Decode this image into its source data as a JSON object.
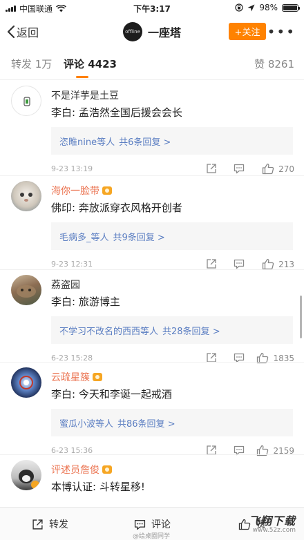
{
  "status_bar": {
    "carrier": "中国联通",
    "time": "下午3:17",
    "battery": "98%",
    "battery_level": 0.98
  },
  "nav": {
    "back_label": "返回",
    "avatar_text": "offline",
    "title": "一座塔",
    "follow_label": "+关注",
    "more_label": "•••"
  },
  "tabs": {
    "repost": "转发 1万",
    "comment": "评论 4423",
    "like": "赞 8261"
  },
  "comments": [
    {
      "username": "不是洋芋是土豆",
      "vip": false,
      "text": "李白:  孟浩然全国后援会会长",
      "replies_users": "恣睢nine等人",
      "replies_count": "共6条回复 >",
      "time": "9-23 13:19",
      "likes": "270"
    },
    {
      "username": "海你一脸带",
      "vip": true,
      "text": "佛印:  奔放派穿衣风格开创者",
      "replies_users": "毛病多_等人",
      "replies_count": "共9条回复 >",
      "time": "9-23 12:31",
      "likes": "213"
    },
    {
      "username": "荔盗园",
      "vip": false,
      "text": "李白:  旅游博主",
      "replies_users": "不学习不改名的西西等人",
      "replies_count": "共28条回复 >",
      "time": "6-23 15:28",
      "likes": "1835"
    },
    {
      "username": "云疏星簇",
      "vip": true,
      "text": "李白:  今天和李诞一起戒酒",
      "replies_users": "蜜瓜小波等人",
      "replies_count": "共86条回复 >",
      "time": "6-23 15:36",
      "likes": "2159"
    },
    {
      "username": "评述员詹俊",
      "vip": true,
      "text": "本博认证:  斗转星移!"
    }
  ],
  "bottom_bar": {
    "repost": "转发",
    "comment": "评论",
    "like": "赞",
    "watermark": "@绘桌圈同学",
    "logo_text": "飞翔下载",
    "logo_url": "www.52z.com"
  },
  "colors": {
    "accent": "#ff8200",
    "link": "#5b7ec2",
    "username_orange": "#eb7350"
  }
}
